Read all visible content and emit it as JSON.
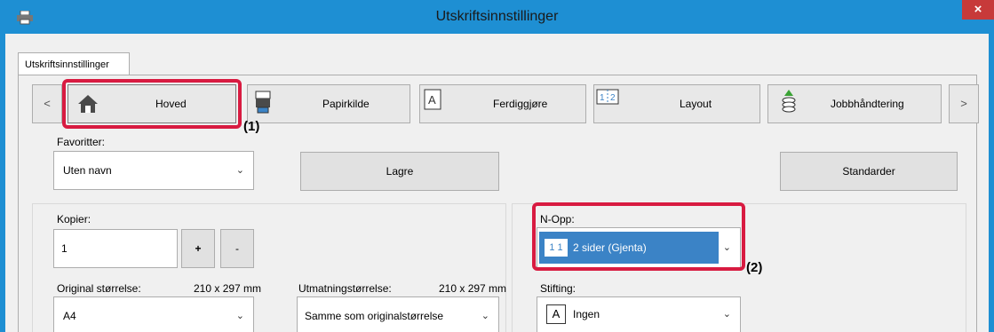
{
  "window": {
    "title": "Utskriftsinnstillinger",
    "close_label": "×"
  },
  "tab": {
    "label": "Utskriftsinnstillinger"
  },
  "nav": {
    "prev_label": "<",
    "next_label": ">"
  },
  "tabs": [
    {
      "label": "Hoved",
      "icon": "home-icon"
    },
    {
      "label": "Papirkilde",
      "icon": "paper-source-icon"
    },
    {
      "label": "Ferdiggjøre",
      "icon": "finishing-icon"
    },
    {
      "label": "Layout",
      "icon": "layout-icon"
    },
    {
      "label": "Jobbhåndtering",
      "icon": "job-handling-icon"
    }
  ],
  "favorites": {
    "label": "Favoritter:",
    "value": "Uten navn",
    "save_label": "Lagre",
    "defaults_label": "Standarder"
  },
  "copies": {
    "label": "Kopier:",
    "value": "1",
    "plus_label": "+",
    "minus_label": "-"
  },
  "original_size": {
    "label": "Original størrelse:",
    "dims": "210 x 297 mm",
    "value": "A4"
  },
  "output_size": {
    "label": "Utmatningstørrelse:",
    "dims": "210 x 297 mm",
    "value": "Samme som originalstørrelse"
  },
  "n_up": {
    "label": "N-Opp:",
    "value": "2 sider (Gjenta)",
    "icon_text": "1 1"
  },
  "stapling": {
    "label": "Stifting:",
    "value": "Ingen",
    "icon_text": "A"
  },
  "callouts": {
    "one": "(1)",
    "two": "(2)"
  },
  "colors": {
    "titlebar": "#1e8fd3",
    "callout": "#d81b41",
    "selection": "#3b83c6"
  }
}
